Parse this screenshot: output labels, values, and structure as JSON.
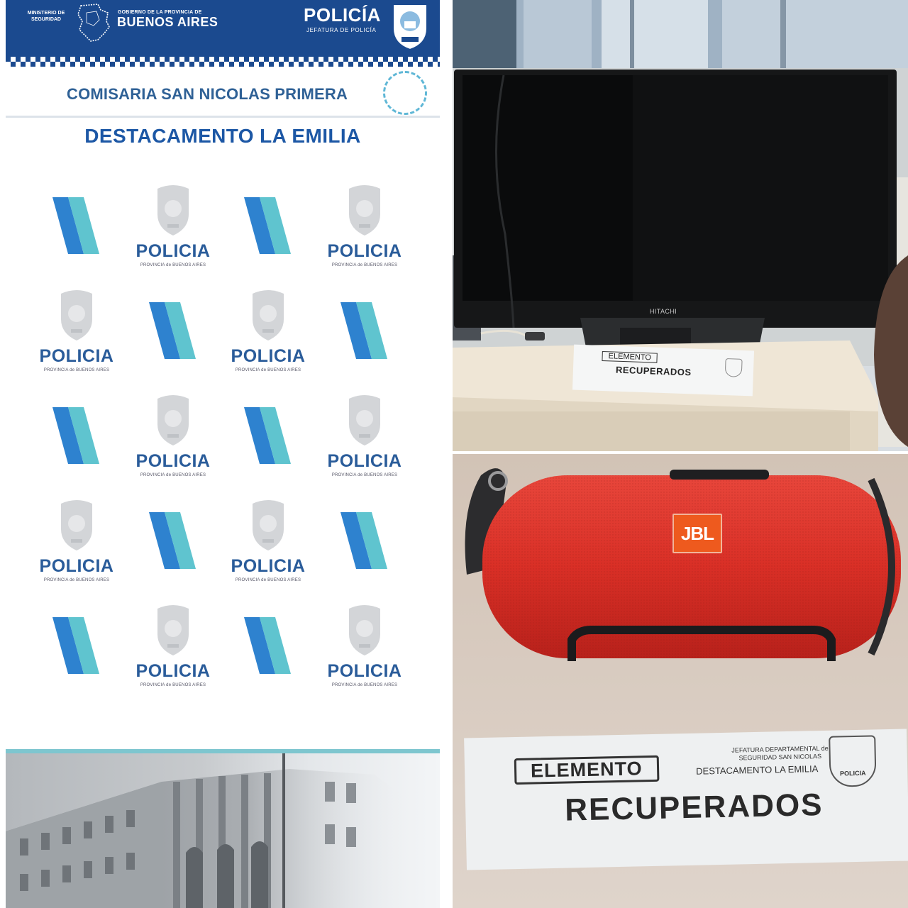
{
  "header": {
    "ministerio": "MINISTERIO DE SEGURIDAD",
    "gobierno_small": "GOBIERNO DE LA PROVINCIA DE",
    "gobierno_big": "BUENOS AIRES",
    "policia": "POLICÍA",
    "jefatura": "JEFATURA DE POLICÍA"
  },
  "comisaria": "COMISARIA SAN NICOLAS PRIMERA",
  "destacamento": "DESTACAMENTO LA EMILIA",
  "logo_pattern": {
    "badge_word": "POLICIA",
    "badge_sub": "PROVINCIA de BUENOS AIRES",
    "rows": [
      [
        "stripes",
        "badge",
        "stripes",
        "badge"
      ],
      [
        "badge",
        "stripes",
        "badge",
        "stripes"
      ],
      [
        "stripes",
        "badge",
        "stripes",
        "badge"
      ],
      [
        "badge",
        "stripes",
        "badge",
        "stripes"
      ],
      [
        "stripes",
        "badge",
        "stripes",
        "badge"
      ]
    ]
  },
  "photo_tv": {
    "brand": "HITACHI",
    "label": {
      "elemento": "ELEMENTO",
      "recuperados": "RECUPERADOS"
    }
  },
  "photo_speaker": {
    "brand": "JBL",
    "label": {
      "elemento": "ELEMENTO",
      "recuperados": "RECUPERADOS",
      "jefatura": "JEFATURA DEPARTAMENTAL de SEGURIDAD SAN NICOLAS",
      "destacamento": "DESTACAMENTO LA EMILIA",
      "seal_word": "POLICIA"
    }
  },
  "colors": {
    "brand_blue": "#1b4a8f",
    "title_blue": "#1c57a5",
    "teal": "#5fc4cf",
    "speaker_red": "#e4322b",
    "jbl_orange": "#ee5a1e"
  }
}
